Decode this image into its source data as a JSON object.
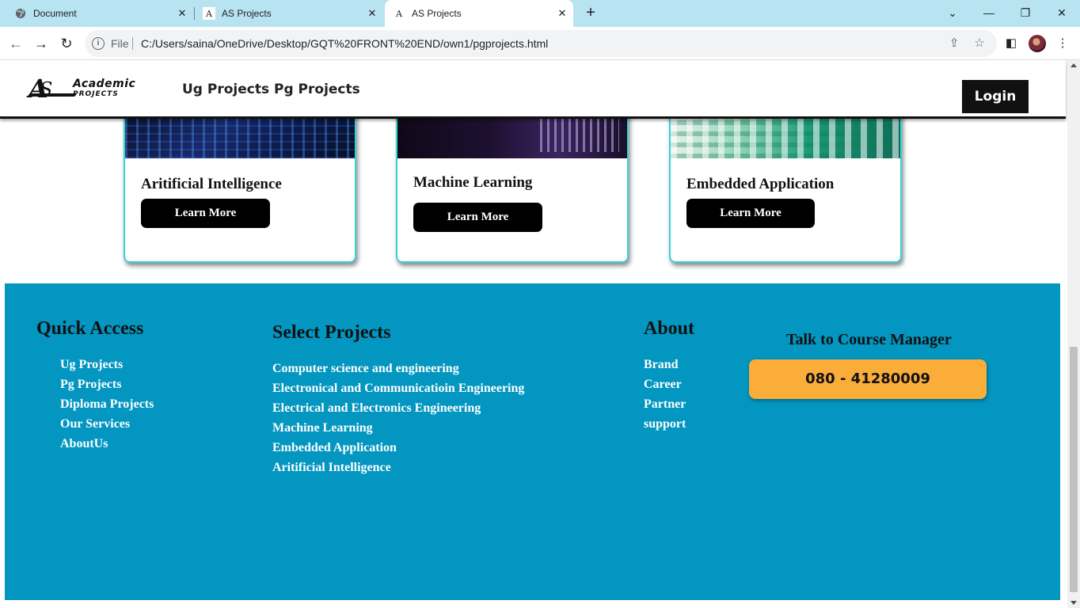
{
  "browser": {
    "tabs": [
      {
        "title": "Document",
        "icon": "globe-icon"
      },
      {
        "title": "AS Projects",
        "icon": "site-logo-icon"
      },
      {
        "title": "AS Projects",
        "icon": "site-logo-icon",
        "active": true
      }
    ],
    "address": {
      "scheme_label": "File",
      "url": "C:/Users/saina/OneDrive/Desktop/GQT%20FRONT%20END/own1/pgprojects.html"
    },
    "colors": {
      "tabstrip": "#b8e3f0"
    }
  },
  "site": {
    "nav": {
      "logo_word1": "Academic",
      "logo_word2": "PROJECTS",
      "links": [
        "Ug Projects",
        "Pg Projects"
      ],
      "login_label": "Login"
    },
    "cards": [
      {
        "title": "Aritificial Intelligence",
        "button": "Learn More",
        "image": "circuit-board-image"
      },
      {
        "title": "Machine Learning",
        "button": "Learn More",
        "image": "data-network-image"
      },
      {
        "title": "Embedded Application",
        "button": "Learn More",
        "image": "green-circuit-image"
      }
    ],
    "footer": {
      "quick_access": {
        "heading": "Quick Access",
        "links": [
          "Ug Projects",
          "Pg Projects",
          "Diploma Projects",
          "Our Services",
          "AboutUs"
        ]
      },
      "select_projects": {
        "heading": "Select Projects",
        "links": [
          "Computer science and engineering",
          "Electronical and Communicatioin Engineering",
          "Electrical and Electronics Engineering",
          "Machine Learning",
          "Embedded Application",
          "Aritificial Intelligence"
        ]
      },
      "about": {
        "heading": "About",
        "links": [
          "Brand",
          "Career",
          "Partner",
          "support"
        ]
      },
      "contact": {
        "heading": "Talk to Course Manager",
        "phone": "080 - 41280009"
      }
    },
    "colors": {
      "footer_bg": "#0296c1",
      "card_border": "#35d3d6",
      "phone_button": "#fbad3a",
      "button_black": "#000000"
    }
  }
}
